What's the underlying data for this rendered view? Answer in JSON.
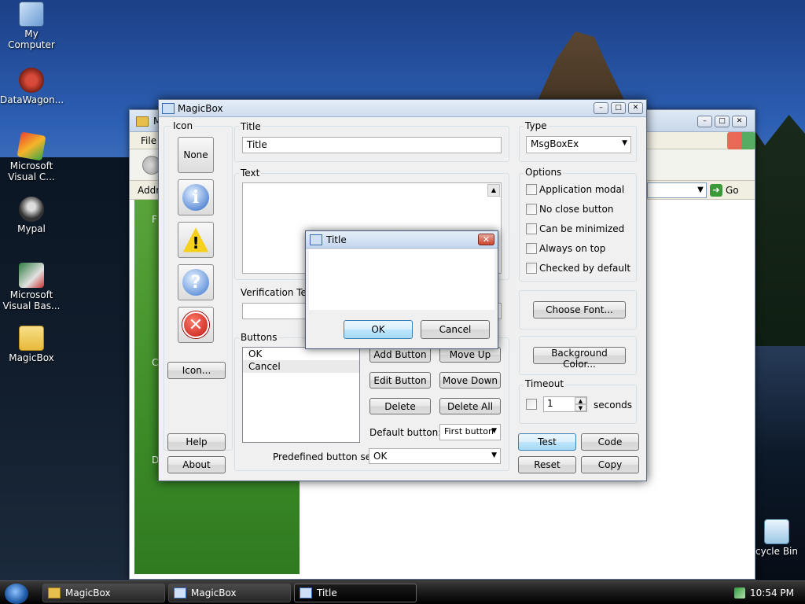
{
  "desktop": {
    "icons": [
      {
        "label": "My Computer",
        "icon": "computer-icon"
      },
      {
        "label": "DataWagon...",
        "icon": "datawagon-icon"
      },
      {
        "label": "Microsoft Visual C...",
        "icon": "visual-c-icon"
      },
      {
        "label": "Mypal",
        "icon": "mypal-icon"
      },
      {
        "label": "Microsoft Visual Bas...",
        "icon": "visual-basic-icon"
      },
      {
        "label": "MagicBox",
        "icon": "folder-icon"
      },
      {
        "label": "cycle Bin",
        "icon": "recycle-bin-icon"
      }
    ]
  },
  "explorer": {
    "title": "M",
    "menu_first": "File",
    "address_label": "Addr",
    "go_label": "Go",
    "left_letters": [
      "F",
      "C",
      "D"
    ]
  },
  "magicbox": {
    "title": "MagicBox",
    "icon_group": {
      "label": "Icon",
      "none_label": "None",
      "icons": [
        "info-icon",
        "warning-icon",
        "question-icon",
        "error-icon"
      ],
      "icon_button_label": "Icon..."
    },
    "title_group": {
      "label": "Title",
      "value": "Title"
    },
    "text_group": {
      "label": "Text",
      "value": ""
    },
    "verification": {
      "label": "Verification Text",
      "value": ""
    },
    "buttons_group": {
      "label": "Buttons",
      "items": [
        "OK",
        "Cancel"
      ],
      "add_label": "Add Button",
      "move_up_label": "Move Up",
      "edit_label": "Edit Button",
      "move_down_label": "Move Down",
      "delete_label": "Delete",
      "delete_all_label": "Delete All",
      "default_label": "Default button:",
      "default_value": "First button",
      "predefined_label": "Predefined button sets:",
      "predefined_value": "OK"
    },
    "type_group": {
      "label": "Type",
      "value": "MsgBoxEx"
    },
    "options": {
      "label": "Options",
      "items": [
        {
          "label": "Application modal",
          "checked": false
        },
        {
          "label": "No close button",
          "checked": false
        },
        {
          "label": "Can be minimized",
          "checked": false
        },
        {
          "label": "Always on top",
          "checked": false
        },
        {
          "label": "Checked by default",
          "checked": false
        }
      ]
    },
    "choose_font_label": "Choose Font...",
    "background_color_label": "Background Color...",
    "timeout": {
      "label": "Timeout",
      "value": "1",
      "unit": "seconds",
      "enabled": false
    },
    "help_label": "Help",
    "about_label": "About",
    "test_label": "Test",
    "code_label": "Code",
    "reset_label": "Reset",
    "copy_label": "Copy"
  },
  "dialog": {
    "title": "Title",
    "close_glyph": "✕",
    "ok_label": "OK",
    "cancel_label": "Cancel"
  },
  "taskbar": {
    "items": [
      {
        "label": "MagicBox",
        "icon": "folder-icon"
      },
      {
        "label": "MagicBox",
        "icon": "window-icon"
      },
      {
        "label": "Title",
        "icon": "window-icon"
      }
    ],
    "clock": "10:54 PM"
  }
}
